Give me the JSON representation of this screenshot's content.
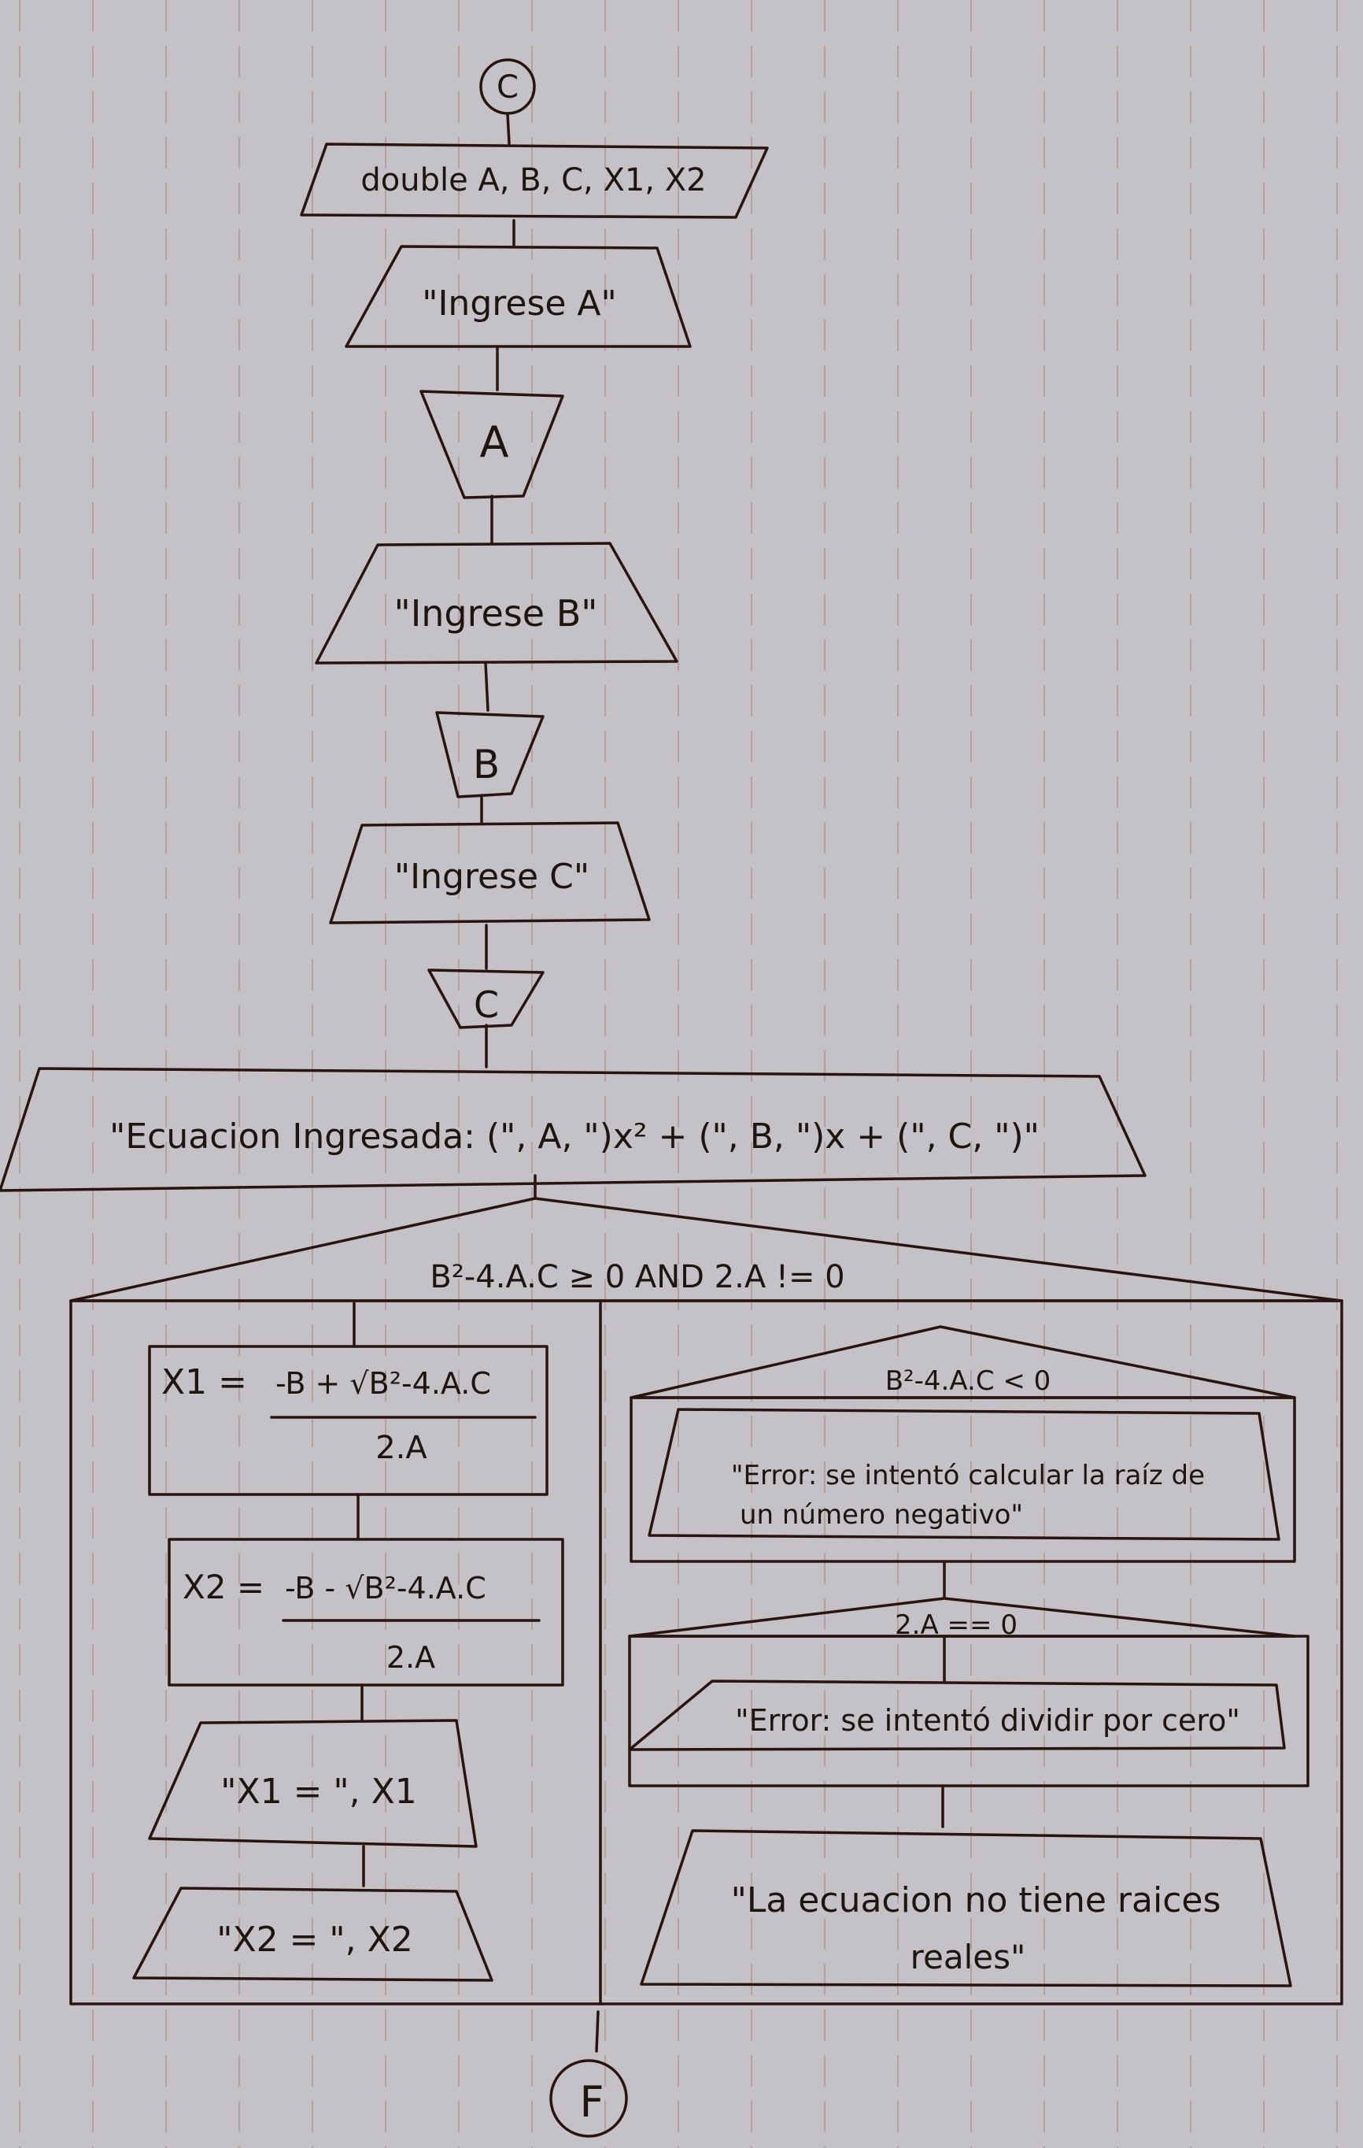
{
  "connectors": {
    "top": "C",
    "bottom": "F"
  },
  "declaration": "double A, B, C, X1, X2",
  "prompt_a": "\"Ingrese A\"",
  "input_a": "A",
  "prompt_b": "\"Ingrese B\"",
  "input_b": "B",
  "prompt_c": "\"Ingrese C\"",
  "input_c": "C",
  "equation_output": "\"Ecuacion Ingresada: (\", A, \")x² + (\", B, \")x + (\", C, \")\"",
  "main_condition": "B²-4.A.C ≥ 0 AND 2.A != 0",
  "x1_formula": {
    "lhs": "X1 =",
    "numerator": "-B + √B²-4.A.C",
    "denominator": "2.A"
  },
  "x2_formula": {
    "lhs": "X2 =",
    "numerator": "-B - √B²-4.A.C",
    "denominator": "2.A"
  },
  "print_x1": "\"X1 = \", X1",
  "print_x2": "\"X2 = \", X2",
  "cond_negative": "B²-4.A.C < 0",
  "error_negative": {
    "line1": "\"Error: se intentó calcular la raíz de",
    "line2": "un número negativo\""
  },
  "cond_zero": "2.A == 0",
  "error_zero": "\"Error: se intentó dividir por cero\"",
  "no_real_roots": {
    "line1": "\"La ecuacion no tiene raices",
    "line2": "reales\""
  }
}
